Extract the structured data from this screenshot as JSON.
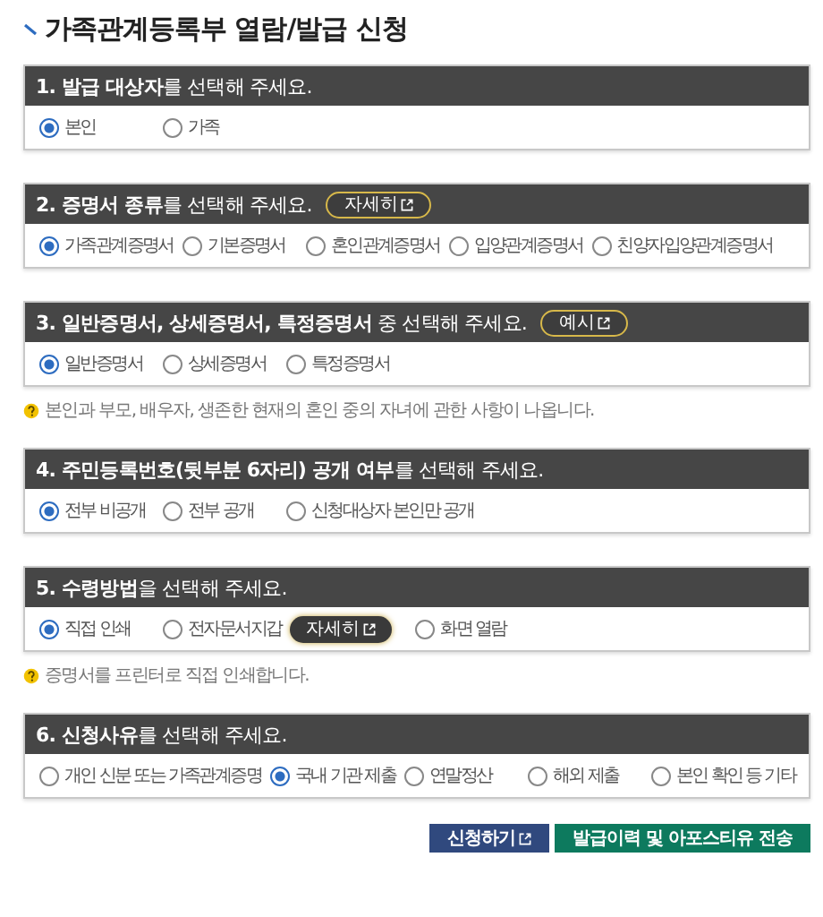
{
  "title": "가족관계등록부 열람/발급 신청",
  "sections": [
    {
      "heading": "**1. 발급 대상자**를 선택해 주세요.",
      "options": [
        {
          "label": "본인",
          "selected": true
        },
        {
          "label": "가족",
          "selected": false
        }
      ]
    },
    {
      "heading": "**2. 증명서 종류**를 선택해 주세요.",
      "header_button": "자세히",
      "options": [
        {
          "label": "가족관계증명서",
          "selected": true
        },
        {
          "label": "기본증명서",
          "selected": false
        },
        {
          "label": "혼인관계증명서",
          "selected": false
        },
        {
          "label": "입양관계증명서",
          "selected": false
        },
        {
          "label": "친양자입양관계증명서",
          "selected": false
        }
      ]
    },
    {
      "heading": "**3. 일반증명서, 상세증명서, 특정증명서** 중 선택해 주세요.",
      "header_button": "예시",
      "options": [
        {
          "label": "일반증명서",
          "selected": true
        },
        {
          "label": "상세증명서",
          "selected": false
        },
        {
          "label": "특정증명서",
          "selected": false
        }
      ],
      "note": "본인과 부모, 배우자, 생존한 현재의 혼인 중의 자녀에 관한 사항이 나옵니다."
    },
    {
      "heading": "**4. 주민등록번호(뒷부분 6자리) 공개 여부**를 선택해 주세요.",
      "options": [
        {
          "label": "전부 비공개",
          "selected": true
        },
        {
          "label": "전부 공개",
          "selected": false
        },
        {
          "label": "신청대상자 본인만 공개",
          "selected": false
        }
      ]
    },
    {
      "heading": "**5. 수령방법**을 선택해 주세요.",
      "options": [
        {
          "label": "직접 인쇄",
          "selected": true
        },
        {
          "label": "전자문서지갑",
          "selected": false,
          "button": "자세히"
        },
        {
          "label": "화면 열람",
          "selected": false
        }
      ],
      "note": "증명서를 프린터로 직접 인쇄합니다."
    },
    {
      "heading": "**6. 신청사유**를 선택해 주세요.",
      "options": [
        {
          "label": "개인 신분 또는 가족관계증명",
          "selected": false
        },
        {
          "label": "국내 기관 제출",
          "selected": true
        },
        {
          "label": "연말정산",
          "selected": false
        },
        {
          "label": "해외 제출",
          "selected": false
        },
        {
          "label": "본인 확인 등 기타",
          "selected": false
        }
      ]
    }
  ],
  "actions": [
    {
      "label": "신청하기",
      "kind": "primary",
      "external": true
    },
    {
      "label": "발급이력 및 아포스티유 전송",
      "kind": "secondary",
      "external": false
    }
  ]
}
